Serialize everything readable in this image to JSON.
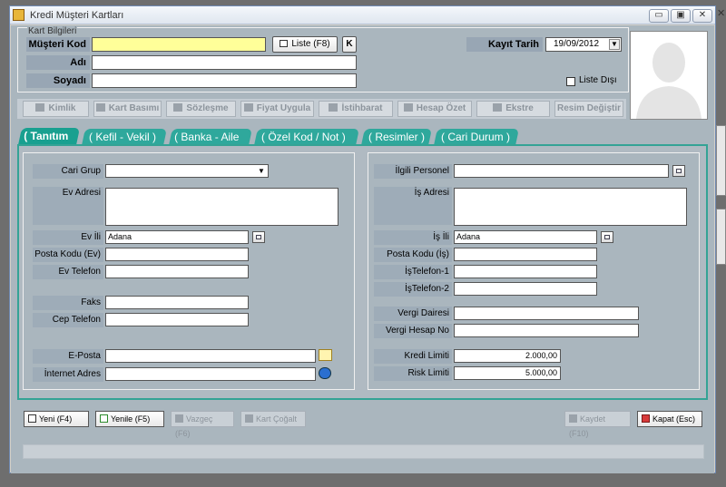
{
  "window": {
    "title": "Kredi Müşteri Kartları",
    "btn_min": "▭",
    "btn_max": "▣",
    "btn_close": "✕",
    "outside_close": "✕"
  },
  "kart": {
    "legend": "Kart Bilgileri",
    "musteri_kod_label": "Müşteri Kod",
    "musteri_kod_value": "",
    "liste_label": "Liste (F8)",
    "k_label": "K",
    "ad_label": "Adı",
    "ad_value": "",
    "soyad_label": "Soyadı",
    "soyad_value": "",
    "kayit_tarih_label": "Kayıt Tarih",
    "kayit_tarih_value": "19/09/2012",
    "liste_disi_label": "Liste Dışı"
  },
  "toolbar": [
    "Kimlik",
    "Kart Basımı",
    "Sözleşme",
    "Fiyat Uygula",
    "İstihbarat",
    "Hesap Özet",
    "Ekstre",
    "Resim Değiştir"
  ],
  "tabs": [
    "( Tanıtım )",
    "( Kefil - Vekil )",
    "( Banka - Aile )",
    "( Özel Kod / Not )",
    "( Resimler )",
    "( Cari Durum )"
  ],
  "left": {
    "cari_grup": "Cari Grup",
    "ev_adresi": "Ev Adresi",
    "ev_ili": "Ev İli",
    "ev_ili_value": "Adana",
    "posta_kodu_ev": "Posta Kodu (Ev)",
    "ev_telefon": "Ev Telefon",
    "faks": "Faks",
    "cep_telefon": "Cep Telefon",
    "e_posta": "E-Posta",
    "internet_adres": "İnternet Adres"
  },
  "right": {
    "ilgili_personel": "İlgili Personel",
    "is_adresi": "İş Adresi",
    "is_ili": "İş İli",
    "is_ili_value": "Adana",
    "posta_kodu_is": "Posta Kodu (İş)",
    "is_telefon_1": "İşTelefon-1",
    "is_telefon_2": "İşTelefon-2",
    "vergi_dairesi": "Vergi Dairesi",
    "vergi_hesap_no": "Vergi Hesap No",
    "kredi_limiti": "Kredi Limiti",
    "kredi_limiti_value": "2.000,00",
    "risk_limiti": "Risk Limiti",
    "risk_limiti_value": "5.000,00"
  },
  "bottom": {
    "yeni": "Yeni (F4)",
    "yenile": "Yenile (F5)",
    "vazgec": "Vazgeç (F6)",
    "kart_cogalt": "Kart Çoğalt",
    "kaydet": "Kaydet (F10)",
    "kapat": "Kapat (Esc)"
  },
  "colors": {
    "accent": "#2fa89c",
    "required": "#ffff99",
    "client": "#aab6be"
  }
}
